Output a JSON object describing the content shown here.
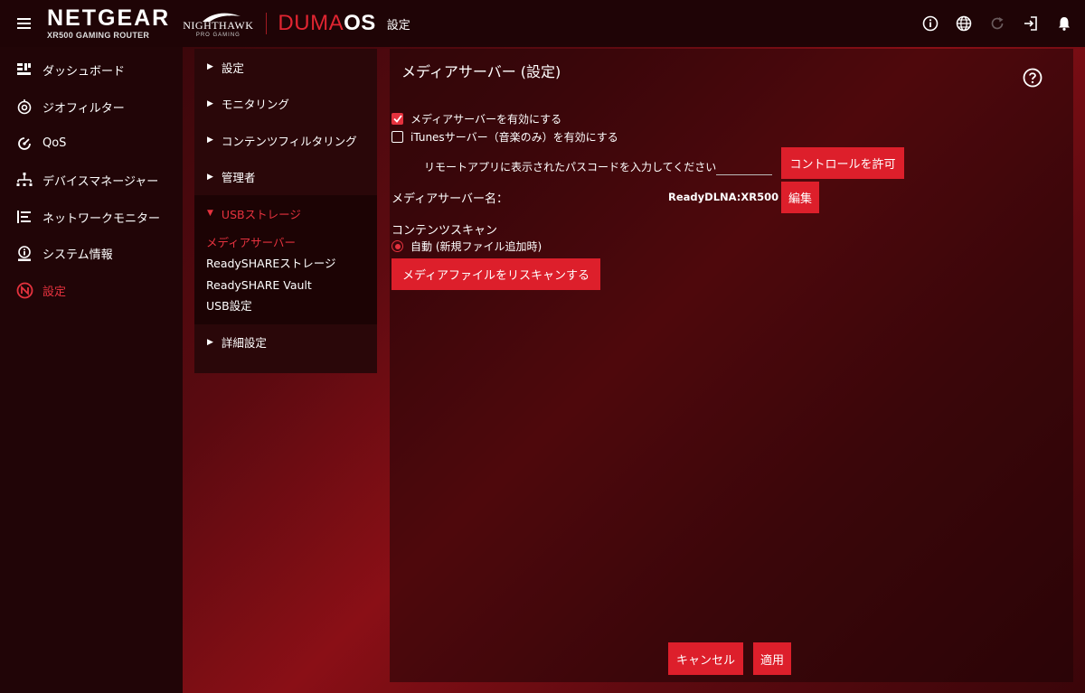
{
  "header": {
    "brand": "NETGEAR",
    "model": "XR500 GAMING ROUTER",
    "nighthawk": "NIGHTHAWK",
    "nighthawk_sub": "PRO GAMING",
    "os_prefix": "DUMA",
    "os_suffix": "OS",
    "page_title": "設定",
    "icons": [
      "info-icon",
      "globe-icon",
      "refresh-icon",
      "logout-icon",
      "bell-icon"
    ]
  },
  "sidebar": {
    "items": [
      {
        "label": "ダッシュボード",
        "icon": "dashboard-icon"
      },
      {
        "label": "ジオフィルター",
        "icon": "geofilter-icon"
      },
      {
        "label": "QoS",
        "icon": "qos-icon"
      },
      {
        "label": "デバイスマネージャー",
        "icon": "device-manager-icon"
      },
      {
        "label": "ネットワークモニター",
        "icon": "network-monitor-icon"
      },
      {
        "label": "システム情報",
        "icon": "system-info-icon"
      },
      {
        "label": "設定",
        "icon": "settings-icon",
        "active": true
      }
    ]
  },
  "subnav": {
    "items": [
      {
        "label": "設定"
      },
      {
        "label": "モニタリング"
      },
      {
        "label": "コンテンツフィルタリング"
      },
      {
        "label": "管理者"
      }
    ],
    "expanded": {
      "label": "USBストレージ",
      "children": [
        {
          "label": "メディアサーバー",
          "active": true
        },
        {
          "label": "ReadySHARE​ストレージ"
        },
        {
          "label": "ReadySHARE Vault"
        },
        {
          "label": "USB設定"
        }
      ]
    },
    "last": {
      "label": "詳細設定"
    }
  },
  "main": {
    "title": "メディアサーバー (設定)",
    "enable_media_server": {
      "label": "メディアサーバーを有効にする",
      "checked": true
    },
    "enable_itunes": {
      "label": "iTunesサーバー（音楽のみ）を有効にする",
      "checked": false
    },
    "passcode_prompt": "リモートアプリに表示されたパスコードを入力してください",
    "passcode_value": "",
    "allow_control_button": "コントロールを許可",
    "server_name_label": "メディアサーバー名：",
    "server_name_value": "ReadyDLNA:XR500",
    "edit_button": "編集",
    "content_scan_label": "コンテンツスキャン",
    "auto_scan_label": "自動 (新規ファイル追加時)",
    "rescan_button": "メディアファイルをリスキャンする",
    "cancel_button": "キャンセル",
    "apply_button": "適用"
  },
  "colors": {
    "accent": "#dd1f2b",
    "active_text": "#e5323e",
    "topbar": "#1f0406",
    "sidebar": "#210507"
  }
}
